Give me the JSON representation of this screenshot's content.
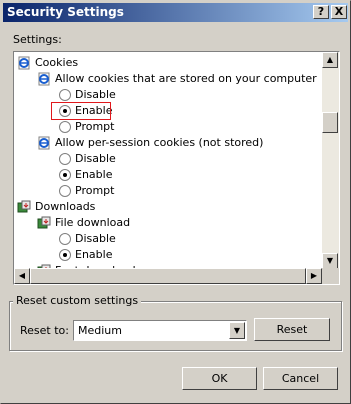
{
  "window": {
    "title": "Security Settings",
    "help_label": "?",
    "close_label": "X"
  },
  "settings_label": "Settings:",
  "tree": [
    {
      "kind": "ie-icon",
      "indent": 0,
      "label": "Cookies"
    },
    {
      "kind": "ie-icon",
      "indent": 1,
      "label": "Allow cookies that are stored on your computer"
    },
    {
      "kind": "radio",
      "indent": 2,
      "label": "Disable",
      "checked": false
    },
    {
      "kind": "radio",
      "indent": 2,
      "label": "Enable",
      "checked": true
    },
    {
      "kind": "radio",
      "indent": 2,
      "label": "Prompt",
      "checked": false
    },
    {
      "kind": "ie-icon",
      "indent": 1,
      "label": "Allow per-session cookies (not stored)"
    },
    {
      "kind": "radio",
      "indent": 2,
      "label": "Disable",
      "checked": false
    },
    {
      "kind": "radio",
      "indent": 2,
      "label": "Enable",
      "checked": true
    },
    {
      "kind": "radio",
      "indent": 2,
      "label": "Prompt",
      "checked": false
    },
    {
      "kind": "download-icon",
      "indent": 0,
      "label": "Downloads"
    },
    {
      "kind": "download-icon",
      "indent": 1,
      "label": "File download"
    },
    {
      "kind": "radio",
      "indent": 2,
      "label": "Disable",
      "checked": false
    },
    {
      "kind": "radio",
      "indent": 2,
      "label": "Enable",
      "checked": true
    },
    {
      "kind": "download-icon",
      "indent": 1,
      "label": "Font download"
    }
  ],
  "reset_group": {
    "title": "Reset custom settings",
    "reset_to_label": "Reset to:",
    "level": "Medium",
    "reset_button": "Reset"
  },
  "buttons": {
    "ok": "OK",
    "cancel": "Cancel"
  },
  "colors": {
    "highlight": "#e0181c",
    "title_start": "#0a246a",
    "title_end": "#a6caf0"
  }
}
